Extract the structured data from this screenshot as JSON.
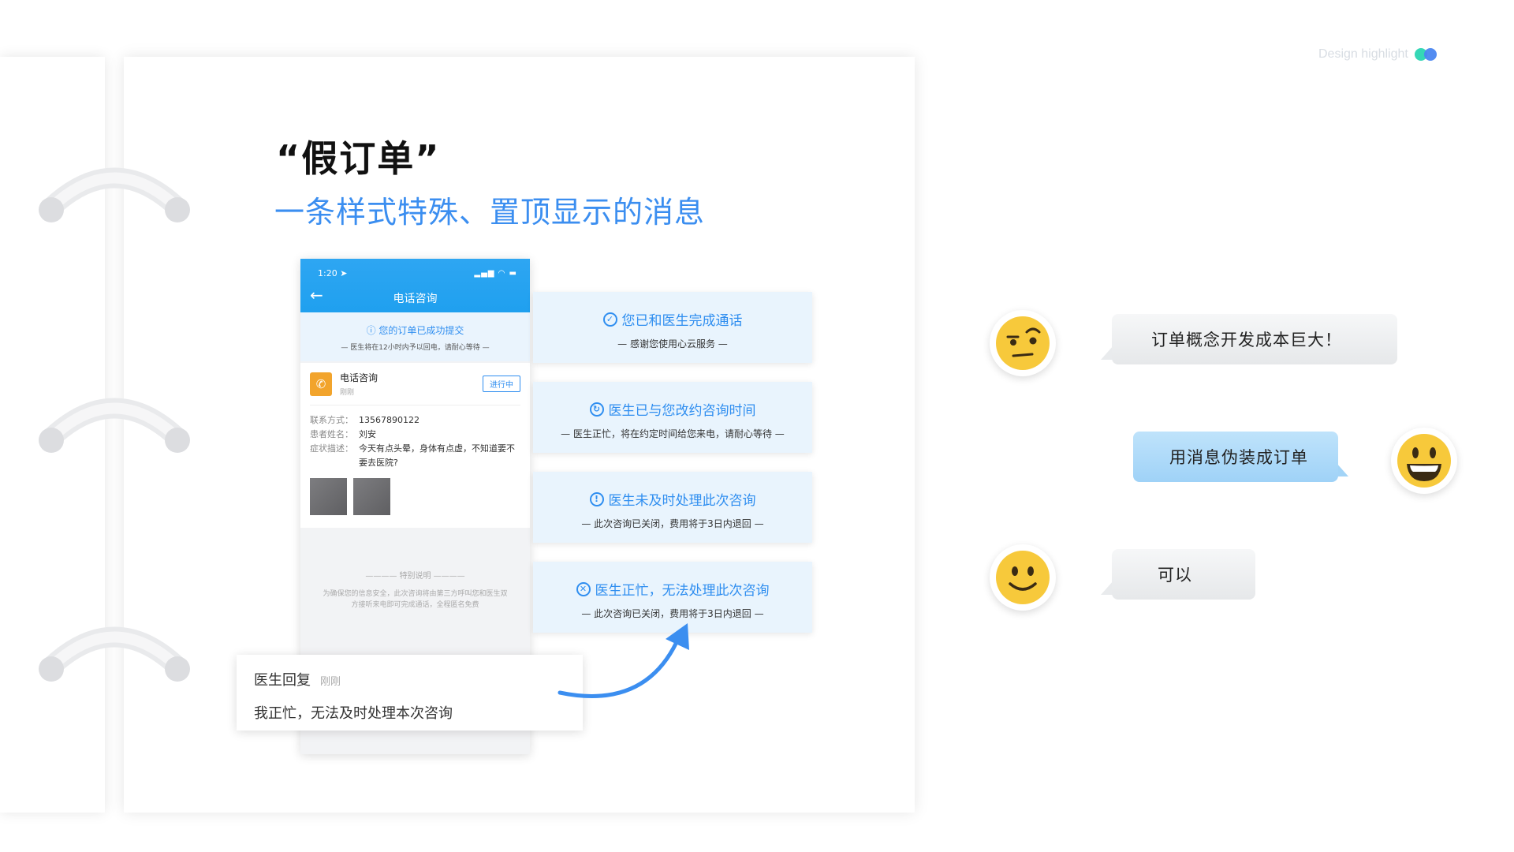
{
  "brand": {
    "text": "Design highlight"
  },
  "slide": {
    "title": "“假订单”",
    "subtitle": "一条样式特殊、置顶显示的消息"
  },
  "phone": {
    "status_time": "1:20 ➤",
    "status_icons": "▂▄▆ ◠ ▬",
    "header_title": "电话咨询",
    "notice": {
      "title": "您的订单已成功提交",
      "subtitle": "— 医生将在12小时内予以回电，请耐心等待 —"
    },
    "order": {
      "name": "电话咨询",
      "time": "刚刚",
      "status": "进行中",
      "info": [
        {
          "label": "联系方式：",
          "value": "13567890122"
        },
        {
          "label": "患者姓名：",
          "value": "刘安"
        },
        {
          "label": "症状描述：",
          "value": "今天有点头晕，身体有点虚，不知道要不要去医院?"
        }
      ]
    },
    "special": {
      "title": "———— 特别说明 ————",
      "text": "为确保您的信息安全，此次咨询将由第三方呼叫您和医生双方接听来电即可完成通话，全程匿名免费"
    }
  },
  "notifications": [
    {
      "icon": "✓",
      "title": "您已和医生完成通话",
      "subtitle": "— 感谢您使用心云服务 —"
    },
    {
      "icon": "↻",
      "title": "医生已与您改约咨询时间",
      "subtitle": "— 医生正忙，将在约定时间给您来电，请耐心等待 —"
    },
    {
      "icon": "!",
      "title": "医生未及时处理此次咨询",
      "subtitle": "— 此次咨询已关闭，费用将于3日内退回 —"
    },
    {
      "icon": "✕",
      "title": "医生正忙，无法处理此次咨询",
      "subtitle": "— 此次咨询已关闭，费用将于3日内退回 —"
    }
  ],
  "reply": {
    "title": "医生回复",
    "time": "刚刚",
    "body": "我正忙，无法及时处理本次咨询"
  },
  "chat": [
    {
      "speaker": "left",
      "emoji": "skeptical-face-icon",
      "text": "订单概念开发成本巨大！"
    },
    {
      "speaker": "right",
      "emoji": "grinning-face-icon",
      "text": "用消息伪装成订单"
    },
    {
      "speaker": "left",
      "emoji": "smiling-face-icon",
      "text": "可以"
    }
  ],
  "colors": {
    "accent": "#3b8ef0",
    "notice_bg": "#e9f4fd",
    "emoji": "#f7c93b"
  }
}
